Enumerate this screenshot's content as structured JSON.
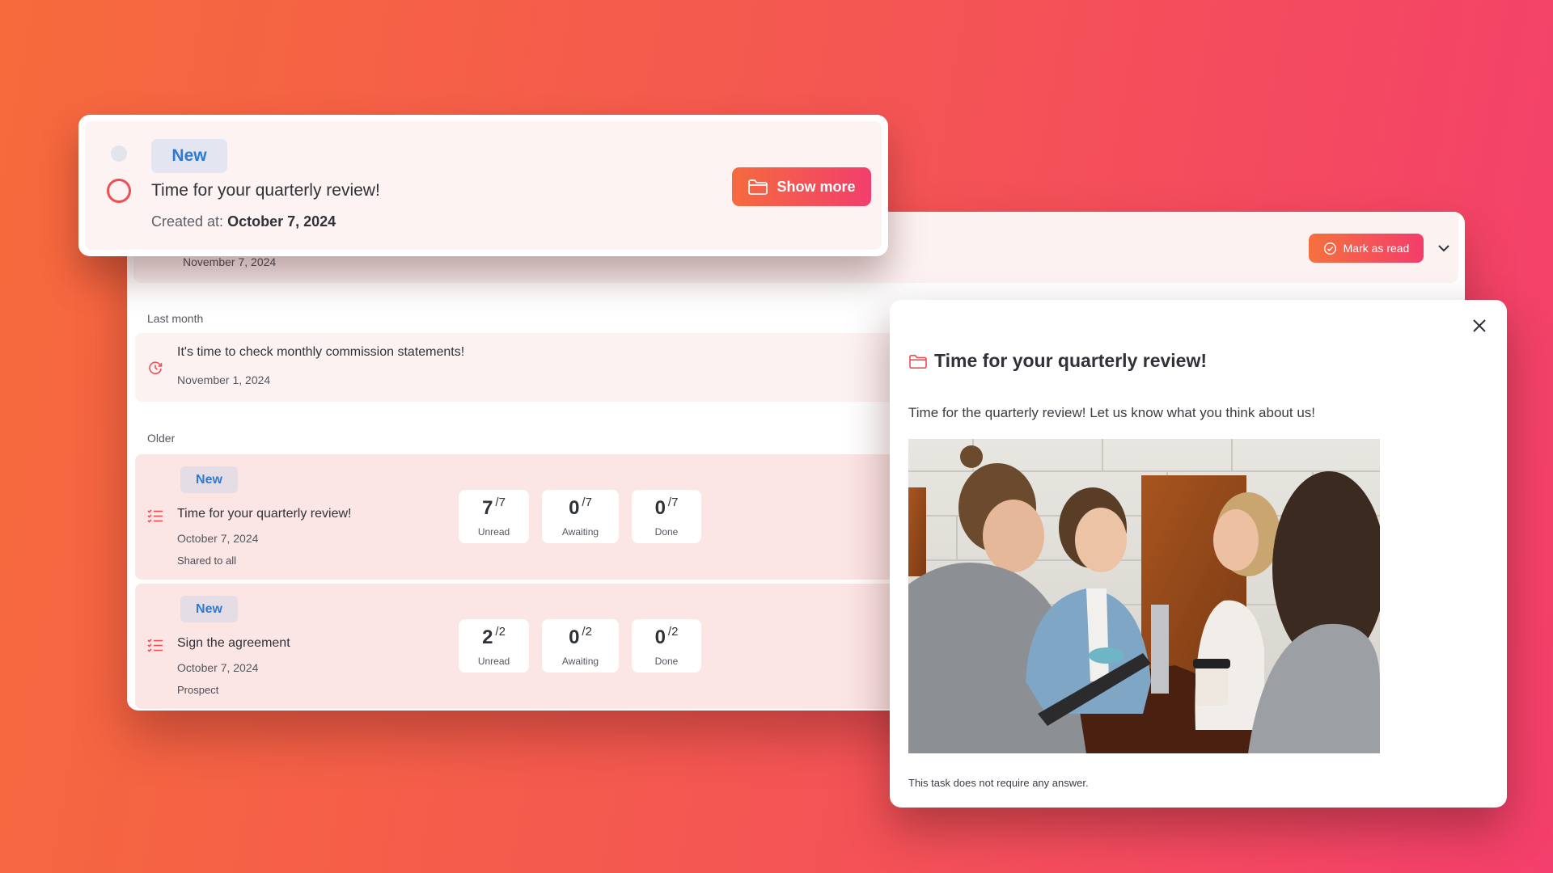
{
  "colors": {
    "accent_start": "#f56a3e",
    "accent_end": "#f23e6d",
    "badge_text": "#2d7ad6",
    "icon_red": "#ef4e52"
  },
  "top_card": {
    "badge": "New",
    "title": "Time for your quarterly review!",
    "created_label": "Created at:",
    "created_value": "October 7, 2024",
    "show_more_label": "Show more",
    "show_more_icon": "folder-icon",
    "status_icon": "radio-circle-icon"
  },
  "panel": {
    "header": {
      "previous_item_date": "November 7, 2024",
      "mark_read_label": "Mark as read",
      "mark_read_icon": "check-circle-icon",
      "expand_icon": "chevron-down-icon"
    },
    "sections": [
      {
        "label": "Last month",
        "items": [
          {
            "icon": "recurring-clock-icon",
            "title": "It's time to check monthly commission statements!",
            "date": "November 1, 2024"
          }
        ]
      },
      {
        "label": "Older",
        "items": [
          {
            "icon": "checklist-icon",
            "badge": "New",
            "title": "Time for your quarterly review!",
            "date": "October 7, 2024",
            "audience": "Shared to all",
            "stats": [
              {
                "value": "7",
                "total": "/7",
                "label": "Unread"
              },
              {
                "value": "0",
                "total": "/7",
                "label": "Awaiting"
              },
              {
                "value": "0",
                "total": "/7",
                "label": "Done"
              }
            ]
          },
          {
            "icon": "checklist-icon",
            "badge": "New",
            "title": "Sign the agreement",
            "date": "October 7, 2024",
            "audience": "Prospect",
            "stats": [
              {
                "value": "2",
                "total": "/2",
                "label": "Unread"
              },
              {
                "value": "0",
                "total": "/2",
                "label": "Awaiting"
              },
              {
                "value": "0",
                "total": "/2",
                "label": "Done"
              }
            ]
          }
        ]
      }
    ]
  },
  "modal": {
    "title_icon": "folder-icon",
    "title": "Time for your quarterly review!",
    "body": "Time for the quarterly review! Let us know what you think about us!",
    "image_alt": "Four people smiling around a cafe table with a tablet and coffee",
    "footer": "This task does not require any answer.",
    "close_icon": "close-icon"
  }
}
